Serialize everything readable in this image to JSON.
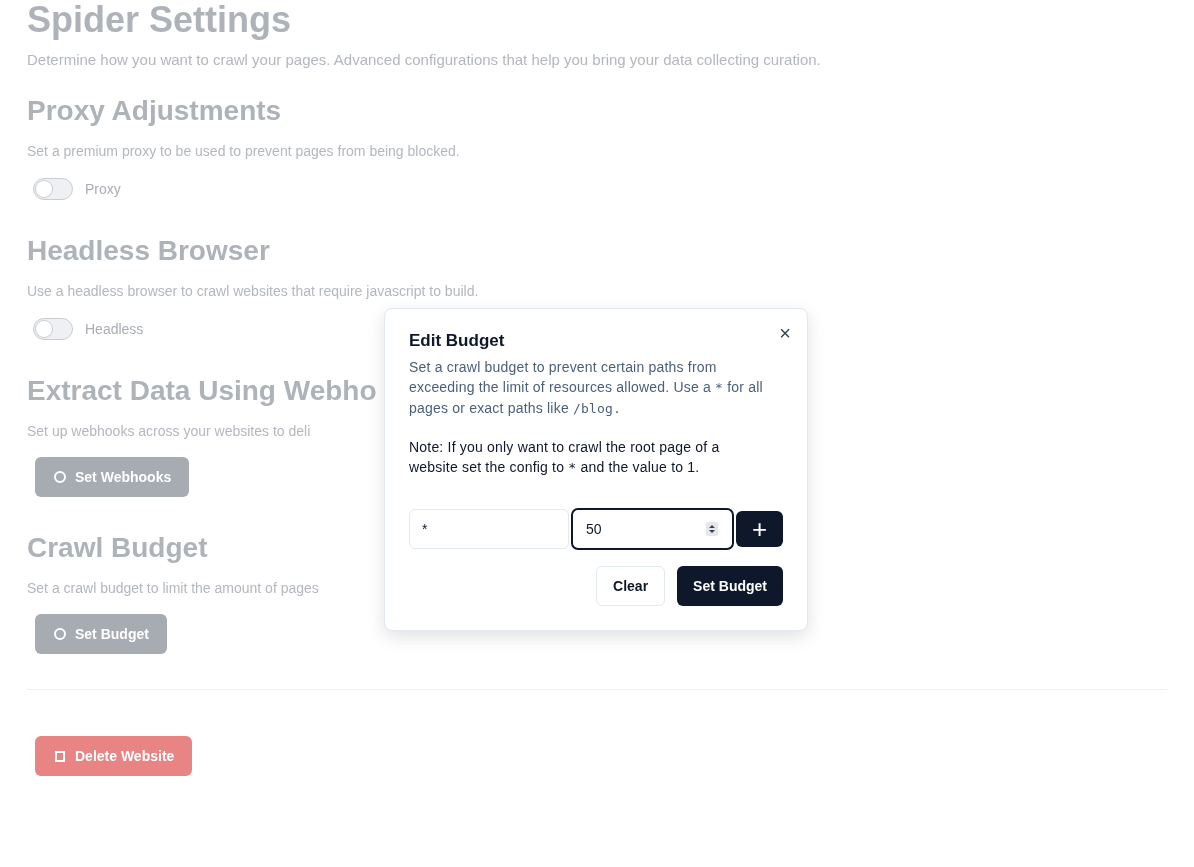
{
  "page": {
    "title": "Spider Settings",
    "subtitle": "Determine how you want to crawl your pages. Advanced configurations that help you bring your data collecting curation.",
    "sections": [
      {
        "kind": "toggle",
        "heading": "Proxy Adjustments",
        "description": "Set a premium proxy to be used to prevent pages from being blocked.",
        "toggle": {
          "label": "Proxy",
          "on": false
        }
      },
      {
        "kind": "toggle",
        "heading": "Headless Browser",
        "description": "Use a headless browser to crawl websites that require javascript to build.",
        "toggle": {
          "label": "Headless",
          "on": false
        }
      },
      {
        "kind": "button",
        "heading": "Extract Data Using Webho",
        "description": "Set up webhooks across your websites to deli",
        "button": "Set Webhooks"
      },
      {
        "kind": "button",
        "heading": "Crawl Budget",
        "description": "Set a crawl budget to limit the amount of pages",
        "button": "Set Budget"
      }
    ],
    "danger_button": "Delete Website"
  },
  "dialog": {
    "title": "Edit Budget",
    "close": "×",
    "description": [
      {
        "kind": "text",
        "text": "Set a crawl budget to prevent certain paths from exceeding the limit of resources allowed. Use a "
      },
      {
        "kind": "code",
        "text": "*"
      },
      {
        "kind": "text",
        "text": " for all pages or exact paths like "
      },
      {
        "kind": "code",
        "text": "/blog."
      }
    ],
    "note": [
      {
        "kind": "text",
        "text": "Note: If you only want to crawl the root page of a website set the config to "
      },
      {
        "kind": "code",
        "text": "*"
      },
      {
        "kind": "text",
        "text": " and the value to 1."
      }
    ],
    "path_value": "*",
    "budget_value": "50",
    "add_button": "+",
    "buttons": [
      {
        "label": "Clear",
        "kind": "secondary"
      },
      {
        "label": "Set Budget",
        "kind": "primary"
      }
    ]
  }
}
